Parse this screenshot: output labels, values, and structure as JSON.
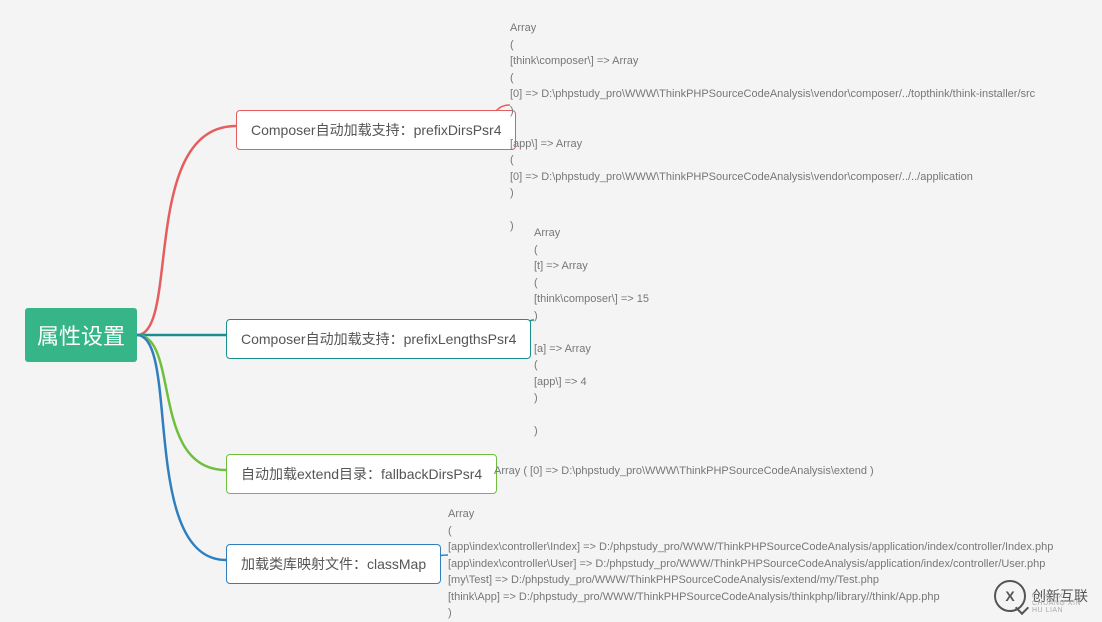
{
  "root": {
    "label": "属性设置"
  },
  "branches": [
    {
      "label": "Composer自动加载支持：prefixDirsPsr4",
      "color": "red",
      "leaf": "Array\n(\n[think\\composer\\] => Array\n(\n[0] => D:\\phpstudy_pro\\WWW\\ThinkPHPSourceCodeAnalysis\\vendor\\composer/../topthink/think-installer/src\n)\n\n[app\\] => Array\n(\n[0] => D:\\phpstudy_pro\\WWW\\ThinkPHPSourceCodeAnalysis\\vendor\\composer/../../application\n)\n\n)"
    },
    {
      "label": "Composer自动加载支持：prefixLengthsPsr4",
      "color": "teal",
      "leaf": "Array\n(\n[t] => Array\n(\n[think\\composer\\] => 15\n)\n\n[a] => Array\n(\n[app\\] => 4\n)\n\n)"
    },
    {
      "label": "自动加载extend目录：fallbackDirsPsr4",
      "color": "green",
      "leaf": "Array ( [0] => D:\\phpstudy_pro\\WWW\\ThinkPHPSourceCodeAnalysis\\extend )"
    },
    {
      "label": "加载类库映射文件：classMap",
      "color": "blue",
      "leaf": "Array\n(\n[app\\index\\controller\\Index] => D:/phpstudy_pro/WWW/ThinkPHPSourceCodeAnalysis/application/index/controller/Index.php\n[app\\index\\controller\\User] => D:/phpstudy_pro/WWW/ThinkPHPSourceCodeAnalysis/application/index/controller/User.php\n[my\\Test] => D:/phpstudy_pro/WWW/ThinkPHPSourceCodeAnalysis/extend/my/Test.php\n[think\\App] => D:/phpstudy_pro/WWW/ThinkPHPSourceCodeAnalysis/thinkphp/library//think/App.php\n)"
    }
  ],
  "watermark": {
    "text": "创新互联",
    "sub": "CXHLCX CHUANG XIN HU LIAN"
  },
  "chart_data": {
    "type": "mindmap",
    "root": "属性设置",
    "children": [
      {
        "label": "Composer自动加载支持：prefixDirsPsr4",
        "content_type": "php_array",
        "content": {
          "think\\composer\\": [
            "D:\\phpstudy_pro\\WWW\\ThinkPHPSourceCodeAnalysis\\vendor\\composer/../topthink/think-installer/src"
          ],
          "app\\": [
            "D:\\phpstudy_pro\\WWW\\ThinkPHPSourceCodeAnalysis\\vendor\\composer/../../application"
          ]
        }
      },
      {
        "label": "Composer自动加载支持：prefixLengthsPsr4",
        "content_type": "php_array",
        "content": {
          "t": {
            "think\\composer\\": 15
          },
          "a": {
            "app\\": 4
          }
        }
      },
      {
        "label": "自动加载extend目录：fallbackDirsPsr4",
        "content_type": "php_array",
        "content": [
          "D:\\phpstudy_pro\\WWW\\ThinkPHPSourceCodeAnalysis\\extend"
        ]
      },
      {
        "label": "加载类库映射文件：classMap",
        "content_type": "php_array",
        "content": {
          "app\\index\\controller\\Index": "D:/phpstudy_pro/WWW/ThinkPHPSourceCodeAnalysis/application/index/controller/Index.php",
          "app\\index\\controller\\User": "D:/phpstudy_pro/WWW/ThinkPHPSourceCodeAnalysis/application/index/controller/User.php",
          "my\\Test": "D:/phpstudy_pro/WWW/ThinkPHPSourceCodeAnalysis/extend/my/Test.php",
          "think\\App": "D:/phpstudy_pro/WWW/ThinkPHPSourceCodeAnalysis/thinkphp/library//think/App.php"
        }
      }
    ]
  }
}
